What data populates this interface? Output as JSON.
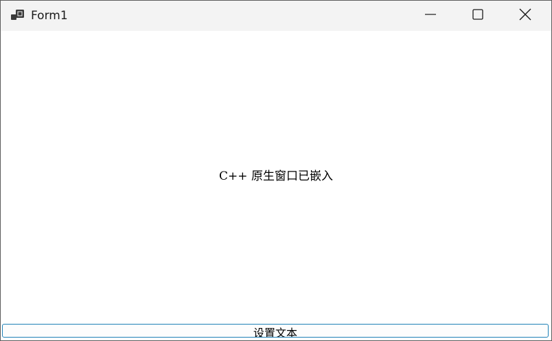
{
  "window": {
    "title": "Form1",
    "icon": "app-window-icon",
    "controls": {
      "minimize": "minimize-icon",
      "maximize": "maximize-icon",
      "close": "close-icon"
    }
  },
  "client": {
    "embedded_label": "C++ 原生窗口已嵌入",
    "set_text_button": "设置文本"
  },
  "colors": {
    "titlebar_bg": "#f3f3f3",
    "client_bg": "#ffffff",
    "button_border": "#1c7fb6"
  }
}
